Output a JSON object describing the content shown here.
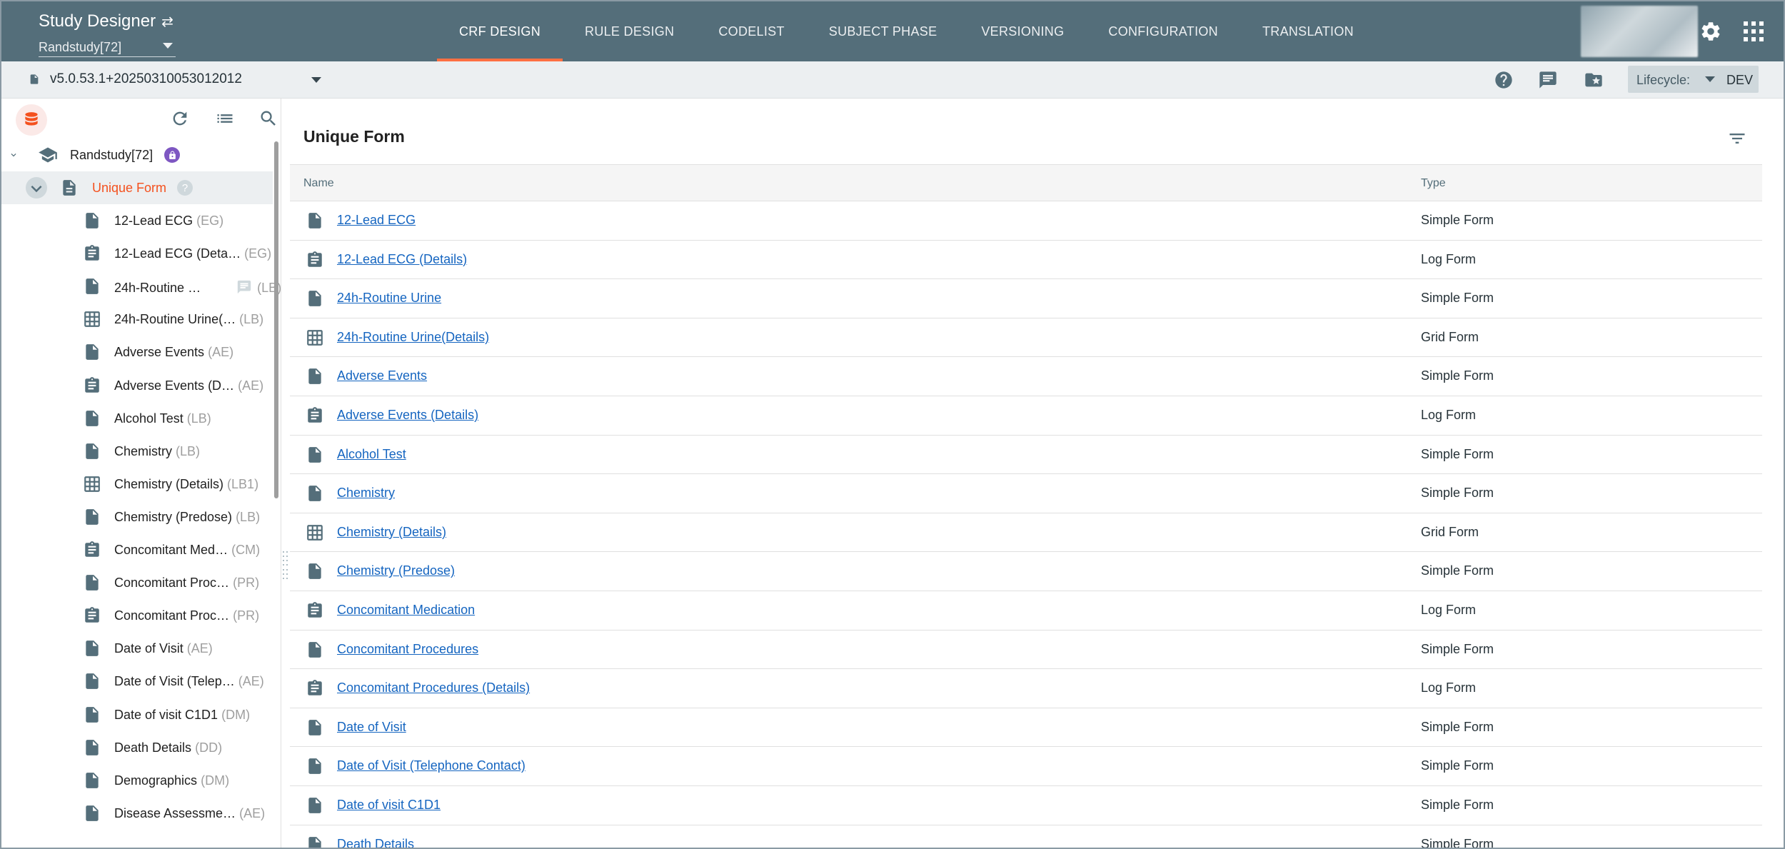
{
  "header": {
    "app_title": "Study Designer",
    "study_select_value": "Randstudy[72]",
    "tabs": [
      {
        "label": "CRF DESIGN",
        "active": true
      },
      {
        "label": "RULE DESIGN",
        "active": false
      },
      {
        "label": "CODELIST",
        "active": false
      },
      {
        "label": "SUBJECT PHASE",
        "active": false
      },
      {
        "label": "VERSIONING",
        "active": false
      },
      {
        "label": "CONFIGURATION",
        "active": false
      },
      {
        "label": "TRANSLATION",
        "active": false
      }
    ],
    "accent_color": "#ff7043",
    "bar_color": "#546e7a"
  },
  "subbar": {
    "version": "v5.0.53.1+20250310053012012",
    "lifecycle_label": "Lifecycle:",
    "lifecycle_value": "DEV"
  },
  "sidebar": {
    "root": {
      "label": "Randstudy[72]",
      "icon": "graduation-cap-icon"
    },
    "selected": {
      "label": "Unique Form",
      "help": "?"
    },
    "items": [
      {
        "name": "12-Lead ECG",
        "code": "(EG)",
        "icon": "document-icon"
      },
      {
        "name": "12-Lead ECG (Deta…",
        "code": "(EG)",
        "icon": "clipboard-icon"
      },
      {
        "name": "24h-Routine …",
        "code": "(LB)",
        "icon": "document-icon",
        "comment": true
      },
      {
        "name": "24h-Routine Urine(…",
        "code": "(LB)",
        "icon": "grid-icon"
      },
      {
        "name": "Adverse Events",
        "code": "(AE)",
        "icon": "document-icon"
      },
      {
        "name": "Adverse Events (D…",
        "code": "(AE)",
        "icon": "clipboard-icon"
      },
      {
        "name": "Alcohol Test",
        "code": "(LB)",
        "icon": "document-icon"
      },
      {
        "name": "Chemistry",
        "code": "(LB)",
        "icon": "document-icon"
      },
      {
        "name": "Chemistry (Details)",
        "code": "(LB1)",
        "icon": "grid-icon"
      },
      {
        "name": "Chemistry (Predose)",
        "code": "(LB)",
        "icon": "document-icon"
      },
      {
        "name": "Concomitant Med…",
        "code": "(CM)",
        "icon": "clipboard-icon"
      },
      {
        "name": "Concomitant Proc…",
        "code": "(PR)",
        "icon": "document-icon"
      },
      {
        "name": "Concomitant Proc…",
        "code": "(PR)",
        "icon": "clipboard-icon"
      },
      {
        "name": "Date of Visit",
        "code": "(AE)",
        "icon": "document-icon"
      },
      {
        "name": "Date of Visit (Telep…",
        "code": "(AE)",
        "icon": "document-icon"
      },
      {
        "name": "Date of visit C1D1",
        "code": "(DM)",
        "icon": "document-icon"
      },
      {
        "name": "Death Details",
        "code": "(DD)",
        "icon": "document-icon"
      },
      {
        "name": "Demographics",
        "code": "(DM)",
        "icon": "document-icon"
      },
      {
        "name": "Disease Assessme…",
        "code": "(AE)",
        "icon": "document-icon"
      }
    ]
  },
  "main": {
    "title": "Unique Form",
    "columns": {
      "name": "Name",
      "type": "Type"
    },
    "rows": [
      {
        "name": "12-Lead ECG",
        "type": "Simple Form",
        "icon": "document-icon"
      },
      {
        "name": "12-Lead ECG (Details)",
        "type": "Log Form",
        "icon": "clipboard-icon"
      },
      {
        "name": "24h-Routine Urine",
        "type": "Simple Form",
        "icon": "document-icon"
      },
      {
        "name": "24h-Routine Urine(Details)",
        "type": "Grid Form",
        "icon": "grid-icon"
      },
      {
        "name": "Adverse Events",
        "type": "Simple Form",
        "icon": "document-icon"
      },
      {
        "name": "Adverse Events (Details)",
        "type": "Log Form",
        "icon": "clipboard-icon"
      },
      {
        "name": "Alcohol Test",
        "type": "Simple Form",
        "icon": "document-icon"
      },
      {
        "name": "Chemistry",
        "type": "Simple Form",
        "icon": "document-icon"
      },
      {
        "name": "Chemistry (Details)",
        "type": "Grid Form",
        "icon": "grid-icon"
      },
      {
        "name": "Chemistry (Predose)",
        "type": "Simple Form",
        "icon": "document-icon"
      },
      {
        "name": "Concomitant Medication",
        "type": "Log Form",
        "icon": "clipboard-icon"
      },
      {
        "name": "Concomitant Procedures",
        "type": "Simple Form",
        "icon": "document-icon"
      },
      {
        "name": "Concomitant Procedures (Details)",
        "type": "Log Form",
        "icon": "clipboard-icon"
      },
      {
        "name": "Date of Visit",
        "type": "Simple Form",
        "icon": "document-icon"
      },
      {
        "name": "Date of Visit (Telephone Contact)",
        "type": "Simple Form",
        "icon": "document-icon"
      },
      {
        "name": "Date of visit C1D1",
        "type": "Simple Form",
        "icon": "document-icon"
      },
      {
        "name": "Death Details",
        "type": "Simple Form",
        "icon": "document-icon"
      }
    ]
  }
}
